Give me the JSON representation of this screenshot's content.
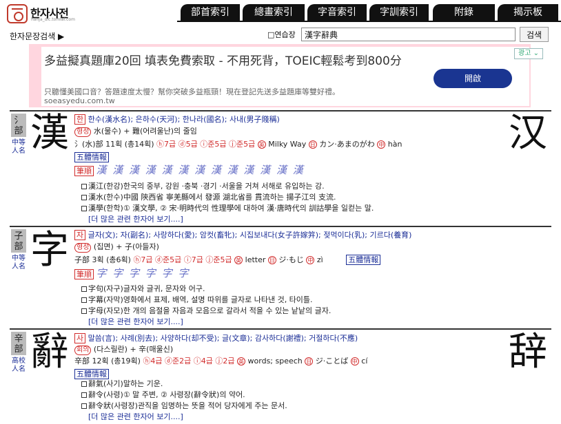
{
  "header": {
    "logo_text": "한자사전",
    "logo_sub": "hanja_dic.tomlai.com",
    "tabs": [
      "部首索引",
      "總畫索引",
      "字音索引",
      "字訓索引",
      "附錄",
      "揭示板"
    ],
    "search_link": "한자문장검색 ▶",
    "memo_label": "□연습장",
    "search_value": "漢字辭典",
    "search_button": "검색"
  },
  "ad": {
    "title": "多益擬真題庫20回 填表免費索取 - 不用死背，TOEIC輕鬆考到800分",
    "desc": "只聽懂美國口音？答題速度太慢？幫你突破多益瓶頸！現在登記先送多益題庫等雙好禮。",
    "url": "soeasyedu.com.tw",
    "button": "開啟",
    "badge": "광고"
  },
  "entries": [
    {
      "radical": "氵部",
      "grade": "中等人名",
      "char": "漢",
      "simplified": "汉",
      "l1_tag": "한",
      "l1_text": "한수(漢水名); 은하수(天河); 한나라(國名); 사내(男子賤稱)",
      "l2_tag": "형성",
      "l2_text": "水(물수) + 難(어려울난)의 줄임",
      "l3_text": "氵(水)部 11획 (총14획)",
      "l3_grades": "ⓗ7급 ⓓ5급 ⓘ준5급 ⓙ준5급",
      "l3_en": "Milky Way",
      "l3_jp": "カン·あまのがわ",
      "l3_cn": "hàn",
      "five_forms": "五體情報",
      "stroke_label": "筆順",
      "strokes": "漢 漢 漢 漢 漢 漢 漢 漢 漢 漢 漢 漢 漢",
      "words": [
        "漢江(한강)한국의 중부, 강원 ·충북 ·경기 ·서울을 거쳐 서해로 유입하는 강.",
        "漢水(한수)中國 陝西省 寧羌縣에서 發源 湖北省를 貫流하는 揚子江의 支流.",
        "漢學(한학)① 漢文學, ② 宋·明時代의 性理學에 대하여 漢·唐時代의 訓詁學을 일컫는 말."
      ],
      "more": "[더 많은 관련 한자어 보기....]"
    },
    {
      "radical": "子部",
      "grade": "中等人名",
      "char": "字",
      "simplified": "",
      "l1_tag": "자",
      "l1_text": "글자(文); 자(副名); 사랑하다(愛); 암컷(畜牝); 시집보내다(女子許嫁笄); 젖먹이다(乳); 기르다(養育)",
      "l2_tag": "형성",
      "l2_text": "(집면) + 子(아들자)",
      "l3_text": "子部 3획 (총6획)",
      "l3_grades": "ⓗ7급 ⓓ준5급 ⓘ7급 ⓙ준5급",
      "l3_en": "letter",
      "l3_jp": "ジ·もじ",
      "l3_cn": "zì",
      "five_forms": "五體情報",
      "stroke_label": "筆順",
      "strokes": "字 字 字 字 字 字",
      "words": [
        "字句(자구)글자와 글귀, 문자와 어구.",
        "字幕(자막)영화에서 표제, 배역, 설명 따위를 글자로 나타낸 것, 타이틀.",
        "字母(자모)한 개의 음절을 자음과 모음으로 갈라서 적을 수 있는 낱낱의 글자."
      ],
      "more": "[더 많은 관련 한자어 보기....]"
    },
    {
      "radical": "辛部",
      "grade": "高校人名",
      "char": "辭",
      "simplified": "辞",
      "l1_tag": "사",
      "l1_text": "말씀(言); 사례(別去); 사양하다(却不受); 글(文章); 감사하다(謝禮); 거절하다(不應)",
      "l2_tag": "회의",
      "l2_text": "(다스릴란) + 辛(매울신)",
      "l3_text": "辛部 12획 (총19획)",
      "l3_grades": "ⓗ4급 ⓓ준2급 ⓘ4급 ⓙ2급",
      "l3_en": "words; speech",
      "l3_jp": "ジ·ことば",
      "l3_cn": "cí",
      "five_forms": "五體情報",
      "stroke_label": "",
      "strokes": "",
      "words": [
        "辭氣(사기)말하는 기운.",
        "辭令(사령)① 말 주변, ② 사령장(辭令狀)의 약어.",
        "辭令狀(사령장)관직을 임명하는 뜻을 적어 당자에게 주는 문서."
      ],
      "more": "[더 많은 관련 한자어 보기....]"
    }
  ]
}
